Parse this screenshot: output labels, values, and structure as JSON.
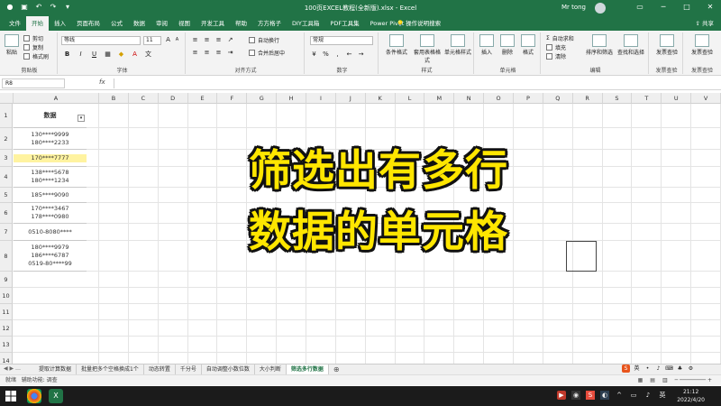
{
  "titlebar": {
    "doc_title": "100页EXCEL教程(全新版).xlsx - Excel",
    "user": "Mr tong"
  },
  "tabs": [
    "文件",
    "开始",
    "插入",
    "页面布局",
    "公式",
    "数据",
    "审阅",
    "视图",
    "开发工具",
    "帮助",
    "方方格子",
    "DIY工具箱",
    "PDF工具集",
    "Power Pivot"
  ],
  "active_tab": "开始",
  "tell_me": "操作说明搜索",
  "share": "共享",
  "ribbon": {
    "paste": "粘贴",
    "cut": "剪切",
    "copy": "复制",
    "format_painter": "格式刷",
    "clipboard_label": "剪贴板",
    "font_name": "等线",
    "font_size": "11",
    "font_label": "字体",
    "wrap_text": "自动换行",
    "merge_center": "合并后居中",
    "align_label": "对齐方式",
    "number_format": "常规",
    "number_label": "数字",
    "conditional_format": "条件格式",
    "format_as_table": "套用表格格式",
    "cell_styles": "单元格样式",
    "styles_label": "样式",
    "insert": "插入",
    "delete": "删除",
    "format": "格式",
    "cells_label": "单元格",
    "autosum": "自动求和",
    "fill": "填充",
    "clear": "清除",
    "sort_filter": "排序和筛选",
    "find_select": "查找和选择",
    "editing_label": "编辑",
    "send_share_1": "发票查验",
    "send_share_2": "发票查验",
    "invoice_label_1": "发票查验",
    "invoice_label_2": "发票查验"
  },
  "formula_bar": {
    "name_box": "R8",
    "fx": "fx"
  },
  "columns": [
    "A",
    "B",
    "C",
    "D",
    "E",
    "F",
    "G",
    "H",
    "I",
    "J",
    "K",
    "L",
    "M",
    "N",
    "O",
    "P",
    "Q",
    "R",
    "S",
    "T",
    "U",
    "V"
  ],
  "rows": [
    "1",
    "2",
    "3",
    "4",
    "5",
    "6",
    "7",
    "8",
    "9",
    "10",
    "11",
    "12",
    "13",
    "14",
    "15",
    "16"
  ],
  "data_header": "数据",
  "data_cells": [
    [
      "130****9999",
      "180****2233"
    ],
    [
      "170****7777"
    ],
    [
      "138****5678",
      "180****1234"
    ],
    [
      "185****9090"
    ],
    [
      "170****3467",
      "178****0980"
    ],
    [
      "0510-8080****"
    ],
    [
      "180****9979",
      "186****6787",
      "0519-80****99"
    ]
  ],
  "overlay": {
    "line1": "筛选出有多行",
    "line2": "数据的单元格"
  },
  "sheet_tabs": [
    "提取计算数据",
    "批量把多个空格换成1个",
    "动态转置",
    "千分号",
    "自动调整小数位数",
    "大小判断",
    "筛选多行数据"
  ],
  "active_sheet": "筛选多行数据",
  "status": {
    "ready": "就绪",
    "accessibility": "辅助功能: 调查"
  },
  "taskbar": {
    "time": "21:12",
    "date": "2022/4/20"
  },
  "colors": {
    "excel_green": "#217346",
    "overlay_yellow": "#ffe600",
    "highlight": "#fff3a0"
  }
}
